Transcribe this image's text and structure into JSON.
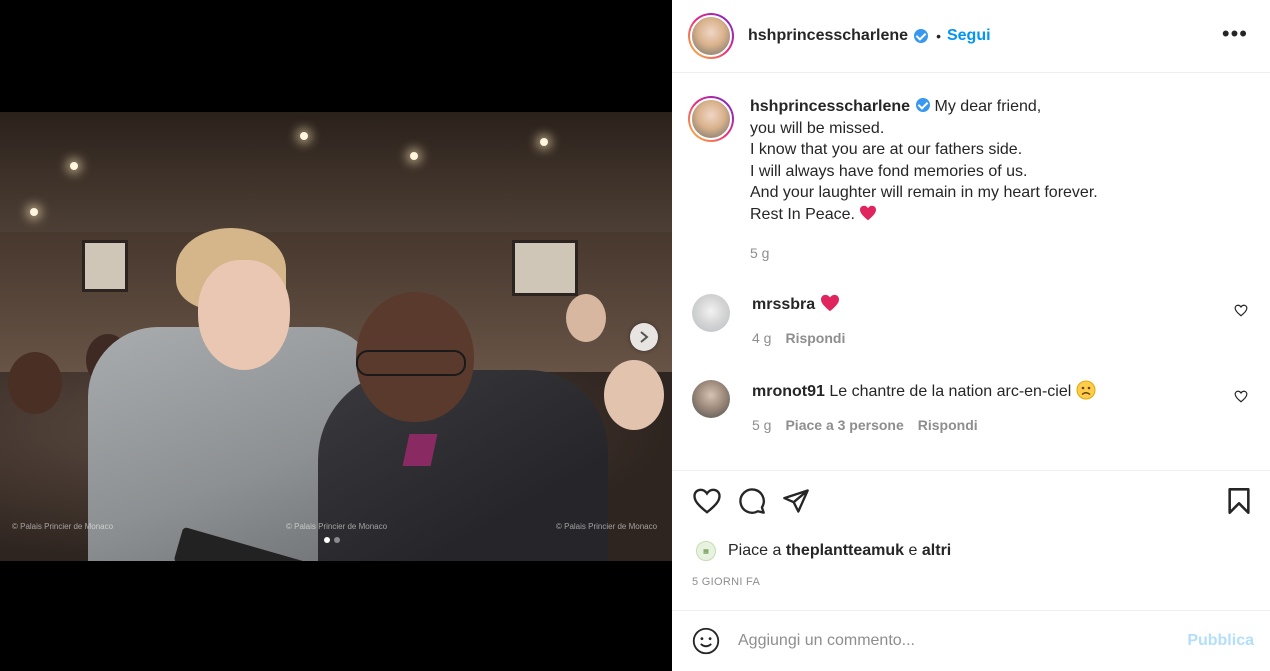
{
  "header": {
    "username": "hshprincesscharlene",
    "bullet": "•",
    "follow_label": "Segui",
    "more_glyph": "•••"
  },
  "caption": {
    "username": "hshprincesscharlene",
    "lines": [
      "My dear friend,",
      "you will be missed.",
      "I know that you are at our fathers side.",
      "I will always have fond memories of us.",
      "And your laughter will remain in my heart forever.",
      "Rest In Peace."
    ],
    "time": "5 g"
  },
  "comments": [
    {
      "username": "mrssbra",
      "text": "",
      "emoji": "heart",
      "time": "4 g",
      "likes": "",
      "reply_label": "Rispondi"
    },
    {
      "username": "mronot91",
      "text": "Le chantre de la nation arc-en-ciel",
      "emoji": "sad-face",
      "time": "5 g",
      "likes": "Piace a 3 persone",
      "reply_label": "Rispondi"
    }
  ],
  "likes": {
    "prefix": "Piace a",
    "user": "theplantteamuk",
    "connector": "e",
    "others": "altri"
  },
  "date_label": "5 GIORNI FA",
  "add_comment": {
    "placeholder": "Aggiungi un commento...",
    "publish_label": "Pubblica"
  },
  "media": {
    "watermarks": [
      "© Palais Princier de Monaco",
      "© Palais Princier de Monaco",
      "© Palais Princier de Monaco"
    ],
    "slide_count": 2,
    "active_slide": 1
  },
  "colors": {
    "accent": "#0095f6",
    "verified": "#3897f0",
    "heart": "#e0245e",
    "muted": "#8e8e8e",
    "publish_disabled": "#b2dffc"
  }
}
